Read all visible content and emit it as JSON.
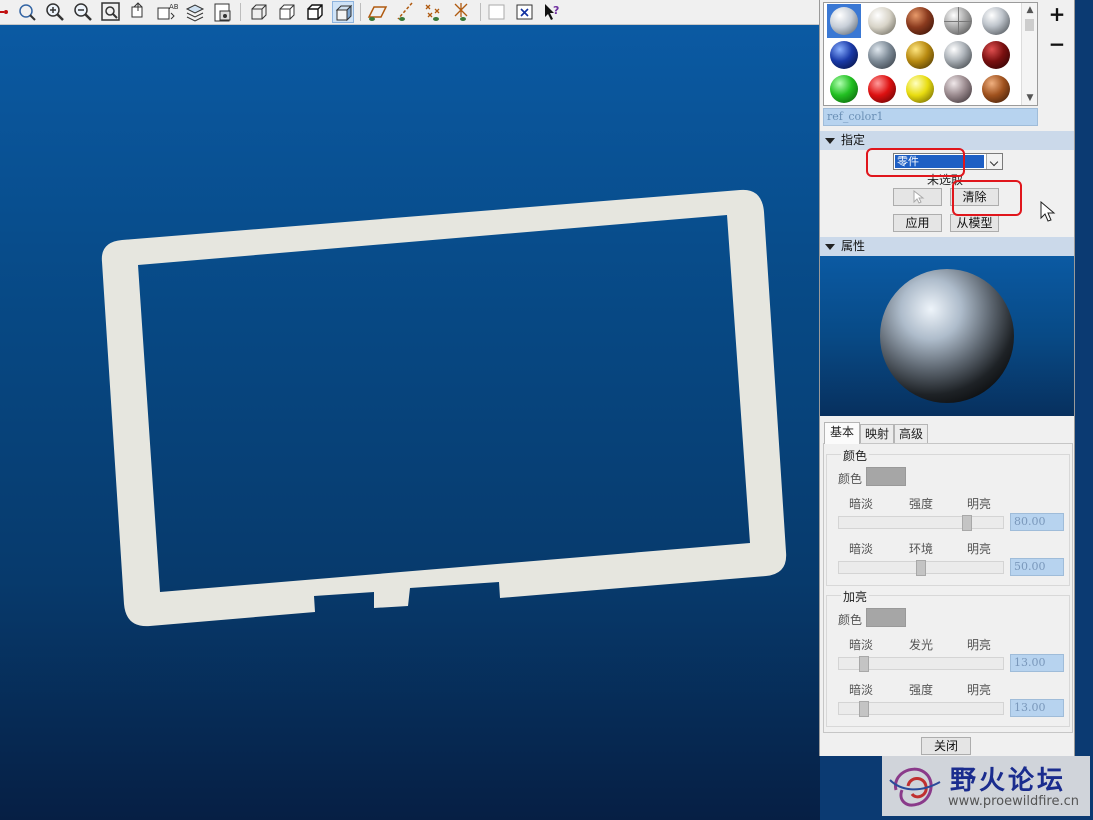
{
  "toolbar": {
    "icons": [
      "pan-icon",
      "reorient-icon",
      "zoom-in-icon",
      "zoom-out-icon",
      "refit-icon",
      "spin-center-icon",
      "view-manager-icon",
      "layers-icon",
      "saved-views-icon",
      "wireframe-icon",
      "hidden-line-icon",
      "no-hidden-icon",
      "shading-icon",
      "datum-planes-icon",
      "datum-axes-icon",
      "datum-points-icon",
      "coordinate-systems-icon",
      "select-box-icon",
      "close-window-icon",
      "context-help-icon"
    ]
  },
  "palette": {
    "swatches": [
      {
        "name": "ref_color1",
        "color": "#c8cfd8"
      },
      {
        "name": "ivory",
        "color": "#d8d4c8"
      },
      {
        "name": "brick",
        "color": "#8a3a1e"
      },
      {
        "name": "crosshair-grey",
        "color": "#a8a8a8"
      },
      {
        "name": "silver",
        "color": "#bfc5cc"
      },
      {
        "name": "blue",
        "color": "#1a3aa8"
      },
      {
        "name": "slate",
        "color": "#7d8a96"
      },
      {
        "name": "gold",
        "color": "#b88a10"
      },
      {
        "name": "chrome",
        "color": "#b0b6bc"
      },
      {
        "name": "maroon",
        "color": "#7a1010"
      },
      {
        "name": "green",
        "color": "#22c022"
      },
      {
        "name": "red",
        "color": "#dd1111"
      },
      {
        "name": "yellow",
        "color": "#e8dc10"
      },
      {
        "name": "granite",
        "color": "#9a8a8e"
      },
      {
        "name": "copper",
        "color": "#a0521e"
      }
    ],
    "plus_label": "+",
    "minus_label": "−",
    "selected_name": "ref_color1"
  },
  "assign": {
    "header": "指定",
    "dropdown_value": "零件",
    "status": "未选取",
    "clear_label": "清除",
    "apply_label": "应用",
    "from_model_label": "从模型"
  },
  "properties": {
    "header": "属性"
  },
  "tabs": [
    "基本",
    "映射",
    "高级"
  ],
  "basic": {
    "color_group": {
      "title": "颜色",
      "color_label": "颜色",
      "slider1": {
        "left": "暗淡",
        "center": "强度",
        "right": "明亮",
        "value": "80.00",
        "fraction": 0.8
      },
      "slider2": {
        "left": "暗淡",
        "center": "环境",
        "right": "明亮",
        "value": "50.00",
        "fraction": 0.5
      }
    },
    "highlight_group": {
      "title": "加亮",
      "color_label": "颜色",
      "slider1": {
        "left": "暗淡",
        "center": "发光",
        "right": "明亮",
        "value": "13.00",
        "fraction": 0.13
      },
      "slider2": {
        "left": "暗淡",
        "center": "强度",
        "right": "明亮",
        "value": "13.00",
        "fraction": 0.13
      }
    }
  },
  "close_label": "关闭",
  "watermark": {
    "title": "野火论坛",
    "url": "www.proewildfire.cn"
  }
}
